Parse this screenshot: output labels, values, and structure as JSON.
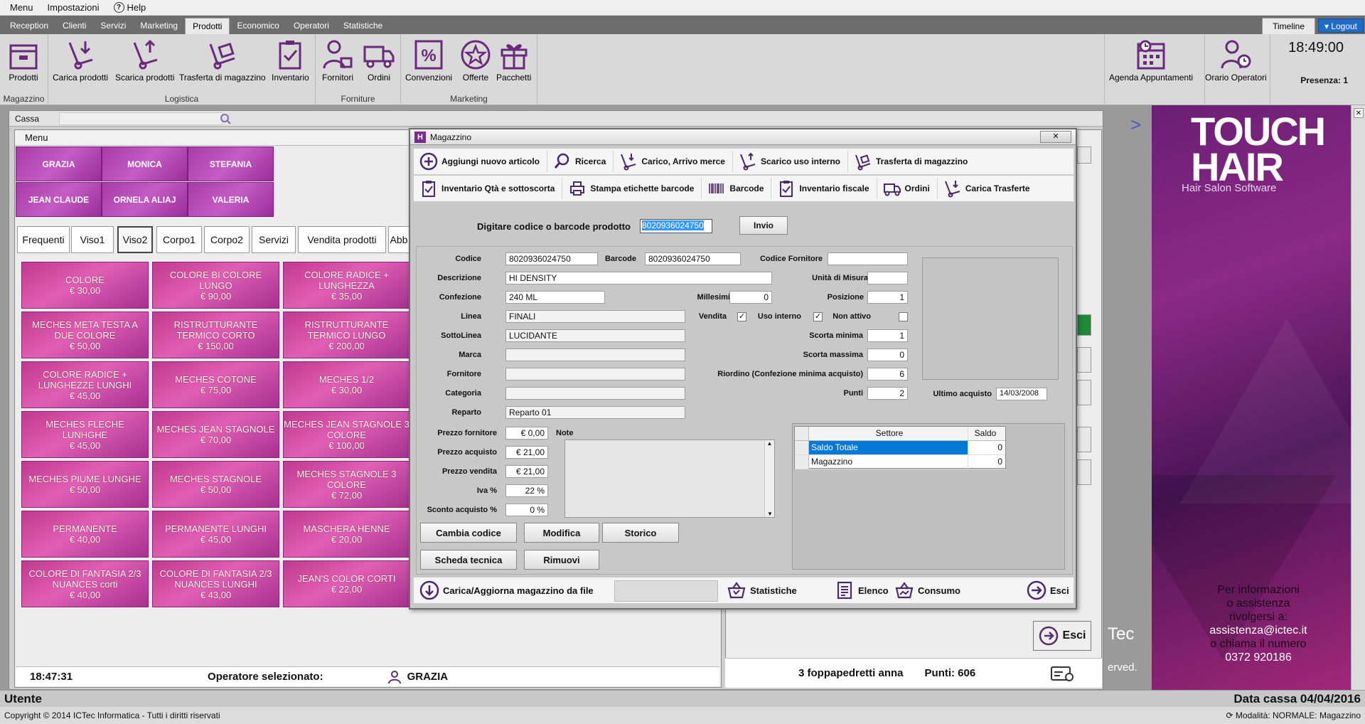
{
  "menubar": {
    "menu": "Menu",
    "settings": "Impostazioni",
    "help": "Help"
  },
  "tabs": [
    "Reception",
    "Clienti",
    "Servizi",
    "Marketing",
    "Prodotti",
    "Economico",
    "Operatori",
    "Statistiche"
  ],
  "active_tab": "Prodotti",
  "timeline": "Timeline",
  "logout": "Logout",
  "ribbon": {
    "magazzino_group": "Magazzino",
    "logistica_group": "Logistica",
    "forniture_group": "Forniture",
    "marketing_group": "Marketing",
    "buttons": {
      "prodotti": "Prodotti",
      "carica": "Carica prodotti",
      "scarica": "Scarica prodotti",
      "trasferta": "Trasferta di magazzino",
      "inventario": "Inventario",
      "fornitori": "Fornitori",
      "ordini": "Ordini",
      "convenzioni": "Convenzioni",
      "offerte": "Offerte",
      "pacchetti": "Pacchetti",
      "agenda": "Agenda Appuntamenti",
      "orario": "Orario Operatori"
    },
    "clock": "18:49:00",
    "presenza": "Presenza: 1"
  },
  "cassa": {
    "title": "Cassa",
    "menu": "Menu"
  },
  "operators": [
    "GRAZIA",
    "MONICA",
    "STEFANIA",
    "JEAN CLAUDE",
    "ORNELA ALIAJ",
    "VALERIA"
  ],
  "category_tabs": [
    "Frequenti",
    "Viso1",
    "Viso2",
    "Corpo1",
    "Corpo2",
    "Servizi",
    "Vendita prodotti",
    "Abb"
  ],
  "active_category": "Viso2",
  "services": [
    {
      "name": "COLORE",
      "price": "€ 30,00"
    },
    {
      "name": "COLORE BI COLORE LUNGO",
      "price": "€ 90,00"
    },
    {
      "name": "COLORE RADICE + LUNGHEZZA",
      "price": "€ 35,00"
    },
    {
      "name": "MECHES META TESTA A DUE COLORE",
      "price": "€ 50,00"
    },
    {
      "name": "RISTRUTTURANTE TERMICO CORTO",
      "price": "€ 150,00"
    },
    {
      "name": "RISTRUTTURANTE TERMICO LUNGO",
      "price": "€ 200,00"
    },
    {
      "name": "COLORE RADICE + LUNGHEZZE LUNGHI",
      "price": "€ 45,00"
    },
    {
      "name": "MECHES COTONE",
      "price": "€ 75,00"
    },
    {
      "name": "MECHES 1/2",
      "price": "€ 30,00"
    },
    {
      "name": "MECHES FLECHE LUNHGHE",
      "price": "€ 45,00"
    },
    {
      "name": "MECHES JEAN STAGNOLE",
      "price": "€ 70,00"
    },
    {
      "name": "MECHES JEAN STAGNOLE 3 COLORE",
      "price": "€ 100,00"
    },
    {
      "name": "MECHES PIUME LUNGHE",
      "price": "€ 50,00"
    },
    {
      "name": "MECHES STAGNOLE",
      "price": "€ 50,00"
    },
    {
      "name": "MECHES STAGNOLE 3 COLORE",
      "price": "€ 72,00"
    },
    {
      "name": "PERMANENTE",
      "price": "€ 40,00"
    },
    {
      "name": "PERMANENTE LUNGHI",
      "price": "€ 45,00"
    },
    {
      "name": "MASCHERA HENNE",
      "price": "€ 20,00"
    },
    {
      "name": "COLORE DI FANTASIA 2/3 NUANCES corti",
      "price": "€ 40,00"
    },
    {
      "name": "COLORE DI FANTASIA 2/3 NUANCES LUNGHI",
      "price": "€ 43,00"
    },
    {
      "name": "JEAN'S COLOR CORTI",
      "price": "€ 22,00"
    }
  ],
  "left_status": {
    "time": "18:47:31",
    "operator_label": "Operatore selezionato:",
    "operator": "GRAZIA"
  },
  "right_status": {
    "client": "3 foppapedretti anna",
    "points": "Punti: 606",
    "esci": "Esci"
  },
  "brand": {
    "logo_line1": "TOUCH",
    "logo_line2": "HAIR",
    "subtitle": "Hair Salon Software",
    "info_lines": [
      "Per informazioni",
      "o assistenza",
      "rivolgersi a:",
      "assistenza@ictec.it",
      "o chiama il numero",
      "0372 920186"
    ],
    "tec": "Tec",
    "rights": "erved."
  },
  "bottom": {
    "utente": "Utente",
    "data_cassa": "Data cassa 04/04/2016",
    "copyright": "Copyright © 2014 ICTec Informatica - Tutti i diritti riservati",
    "modalita": "Modalità: NORMALE: Magazzino"
  },
  "dialog": {
    "title": "Magazzino",
    "toolbar1": [
      "Aggiungi nuovo articolo",
      "Ricerca",
      "Carico, Arrivo merce",
      "Scarico uso interno",
      "Trasferta di magazzino"
    ],
    "toolbar2": [
      "Inventario Qtà e sottoscorta",
      "Stampa etichette barcode",
      "Barcode",
      "Inventario fiscale",
      "Ordini",
      "Carica Trasferte"
    ],
    "prompt": "Digitare codice o barcode prodotto",
    "barcode_value": "8020936024750",
    "invio": "Invio",
    "labels": {
      "codice": "Codice",
      "barcode": "Barcode",
      "codice_fornitore": "Codice Fornitore",
      "descrizione": "Descrizione",
      "unita": "Unità di Misura",
      "confezione": "Confezione",
      "millesimi": "Millesimi",
      "posizione": "Posizione",
      "linea": "Linea",
      "vendita": "Vendita",
      "uso_interno": "Uso interno",
      "non_attivo": "Non attivo",
      "sottolinea": "SottoLinea",
      "scorta_minima": "Scorta minima",
      "marca": "Marca",
      "scorta_massima": "Scorta massima",
      "fornitore": "Fornitore",
      "riordino": "Riordino (Confezione minima acquisto)",
      "categoria": "Categoria",
      "punti": "Punti",
      "reparto": "Reparto",
      "ultimo_acquisto": "Ultimo acquisto",
      "prezzo_fornitore": "Prezzo fornitore",
      "note": "Note",
      "prezzo_acquisto": "Prezzo acquisto",
      "prezzo_vendita": "Prezzo vendita",
      "iva": "Iva %",
      "sconto": "Sconto acquisto %"
    },
    "values": {
      "codice": "8020936024750",
      "barcode": "8020936024750",
      "codice_fornitore": "",
      "descrizione": "HI DENSITY",
      "unita": "",
      "confezione": "240 ML",
      "millesimi": "0",
      "posizione": "1",
      "linea": "FINALI",
      "sottolinea": "LUCIDANTE",
      "scorta_minima": "1",
      "marca": "",
      "scorta_massima": "0",
      "fornitore": "",
      "riordino": "6",
      "categoria": "",
      "punti": "2",
      "reparto": "Reparto 01",
      "ultimo_acquisto": "14/03/2008",
      "prezzo_fornitore": "€ 0,00",
      "prezzo_acquisto": "€ 21,00",
      "prezzo_vendita": "€ 21,00",
      "iva": "22 %",
      "sconto": "0 %"
    },
    "vendita_checked": true,
    "uso_interno_checked": true,
    "non_attivo_checked": false,
    "settore_table": {
      "headers": [
        "Settore",
        "Saldo"
      ],
      "rows": [
        {
          "settore": "Saldo Totale",
          "saldo": "0"
        },
        {
          "settore": "Magazzino",
          "saldo": "0"
        }
      ]
    },
    "buttons": {
      "cambia_codice": "Cambia codice",
      "modifica": "Modifica",
      "storico": "Storico",
      "scheda_tecnica": "Scheda tecnica",
      "rimuovi": "Rimuovi"
    },
    "bottom_toolbar": {
      "carica": "Carica/Aggiorna magazzino da file",
      "statistiche": "Statistiche",
      "elenco": "Elenco",
      "consumo": "Consumo",
      "esci": "Esci"
    }
  }
}
